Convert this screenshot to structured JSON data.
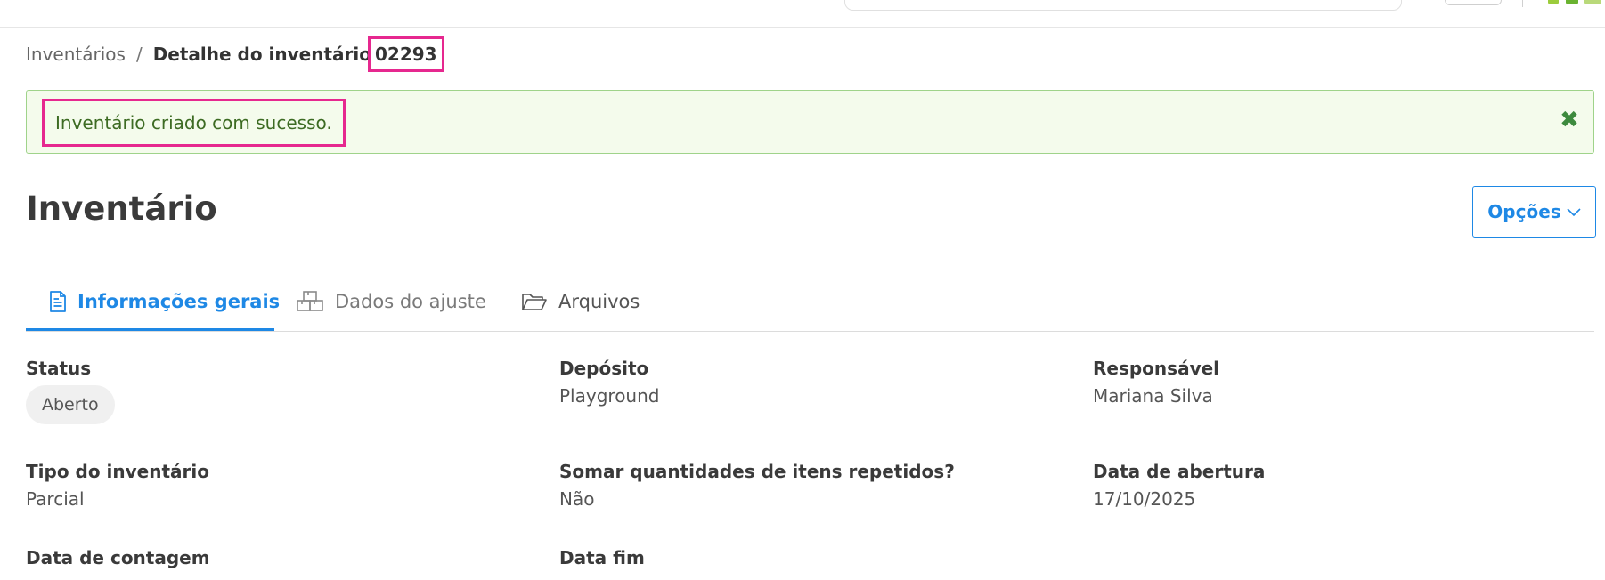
{
  "breadcrumb": {
    "parent": "Inventários",
    "separator": "/",
    "current": "Detalhe do inventário",
    "id": "02293"
  },
  "alert": {
    "message": "Inventário criado com sucesso.",
    "close_icon": "close-icon",
    "color": "#3d6b23",
    "background": "#f4fbec"
  },
  "page": {
    "title": "Inventário",
    "options_label": "Opções"
  },
  "tabs": [
    {
      "label": "Informações gerais",
      "icon": "document-icon",
      "active": true
    },
    {
      "label": "Dados do ajuste",
      "icon": "boxes-icon",
      "active": false
    },
    {
      "label": "Arquivos",
      "icon": "folder-open-icon",
      "active": false
    }
  ],
  "fields": {
    "status": {
      "label": "Status",
      "value": "Aberto"
    },
    "deposito": {
      "label": "Depósito",
      "value": "Playground"
    },
    "responsavel": {
      "label": "Responsável",
      "value": "Mariana Silva"
    },
    "tipo": {
      "label": "Tipo do inventário",
      "value": "Parcial"
    },
    "somar": {
      "label": "Somar quantidades de itens repetidos?",
      "value": "Não"
    },
    "data_abertura": {
      "label": "Data de abertura",
      "value": "17/10/2025"
    },
    "data_contagem": {
      "label": "Data de contagem"
    },
    "data_fim": {
      "label": "Data fim"
    }
  },
  "colors": {
    "accent": "#1e88e5",
    "highlight": "#e6288f",
    "alert_border": "#9fd38a"
  }
}
